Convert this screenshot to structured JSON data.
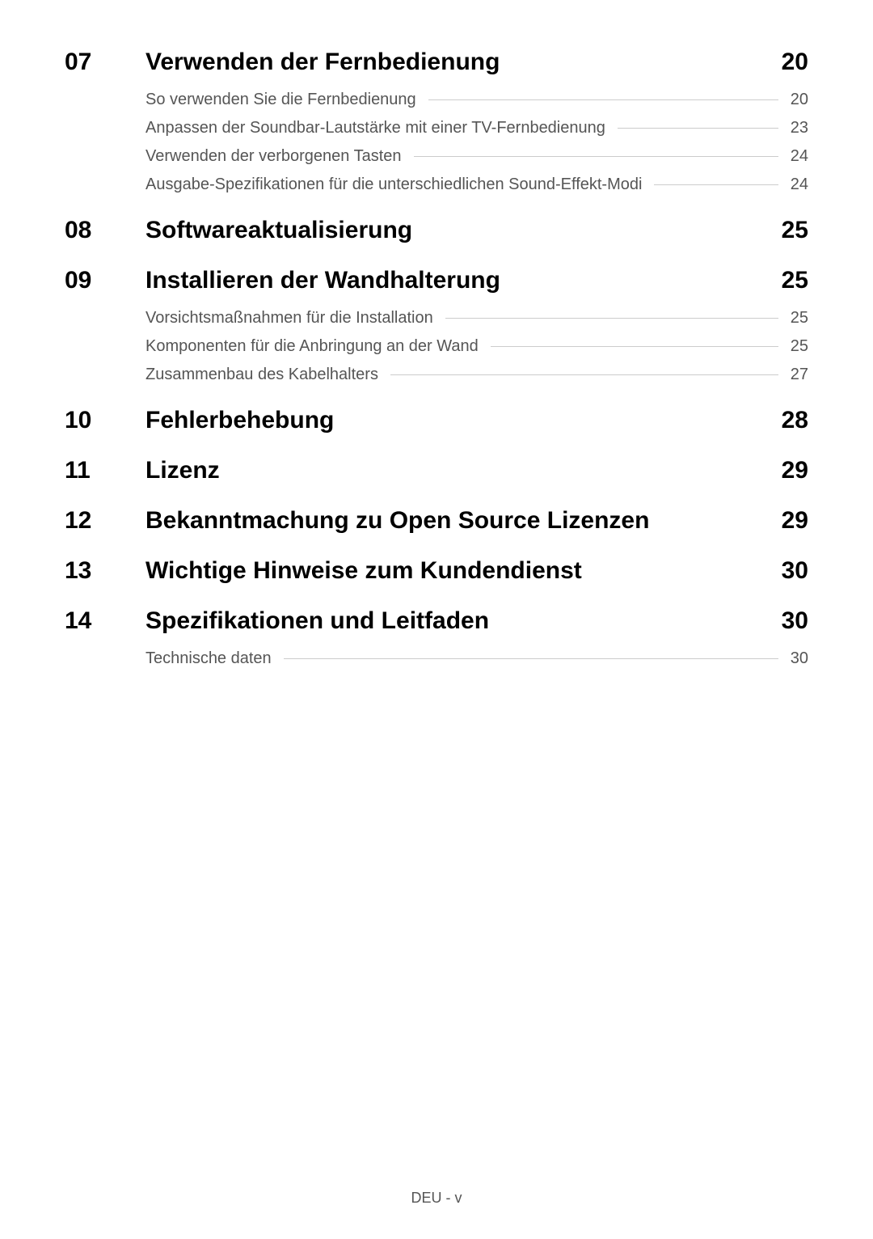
{
  "toc": [
    {
      "number": "07",
      "title": "Verwenden der Fernbedienung",
      "page": "20",
      "subs": [
        {
          "title": "So verwenden Sie die Fernbedienung",
          "page": "20"
        },
        {
          "title": "Anpassen der Soundbar-Lautstärke mit einer TV-Fernbedienung",
          "page": "23"
        },
        {
          "title": "Verwenden der verborgenen Tasten",
          "page": "24"
        },
        {
          "title": "Ausgabe-Spezifikationen für die unterschiedlichen Sound-Effekt-Modi",
          "page": "24"
        }
      ]
    },
    {
      "number": "08",
      "title": "Softwareaktualisierung",
      "page": "25",
      "subs": []
    },
    {
      "number": "09",
      "title": "Installieren der Wandhalterung",
      "page": "25",
      "subs": [
        {
          "title": "Vorsichtsmaßnahmen für die Installation",
          "page": "25"
        },
        {
          "title": "Komponenten für die Anbringung an der Wand",
          "page": "25"
        },
        {
          "title": "Zusammenbau des Kabelhalters",
          "page": "27"
        }
      ]
    },
    {
      "number": "10",
      "title": "Fehlerbehebung",
      "page": "28",
      "subs": []
    },
    {
      "number": "11",
      "title": "Lizenz",
      "page": "29",
      "subs": []
    },
    {
      "number": "12",
      "title": "Bekanntmachung zu Open Source Lizenzen",
      "page": "29",
      "subs": []
    },
    {
      "number": "13",
      "title": "Wichtige Hinweise zum Kundendienst",
      "page": "30",
      "subs": []
    },
    {
      "number": "14",
      "title": "Spezifikationen und Leitfaden",
      "page": "30",
      "subs": [
        {
          "title": "Technische daten",
          "page": "30"
        }
      ]
    }
  ],
  "footer": "DEU - v"
}
